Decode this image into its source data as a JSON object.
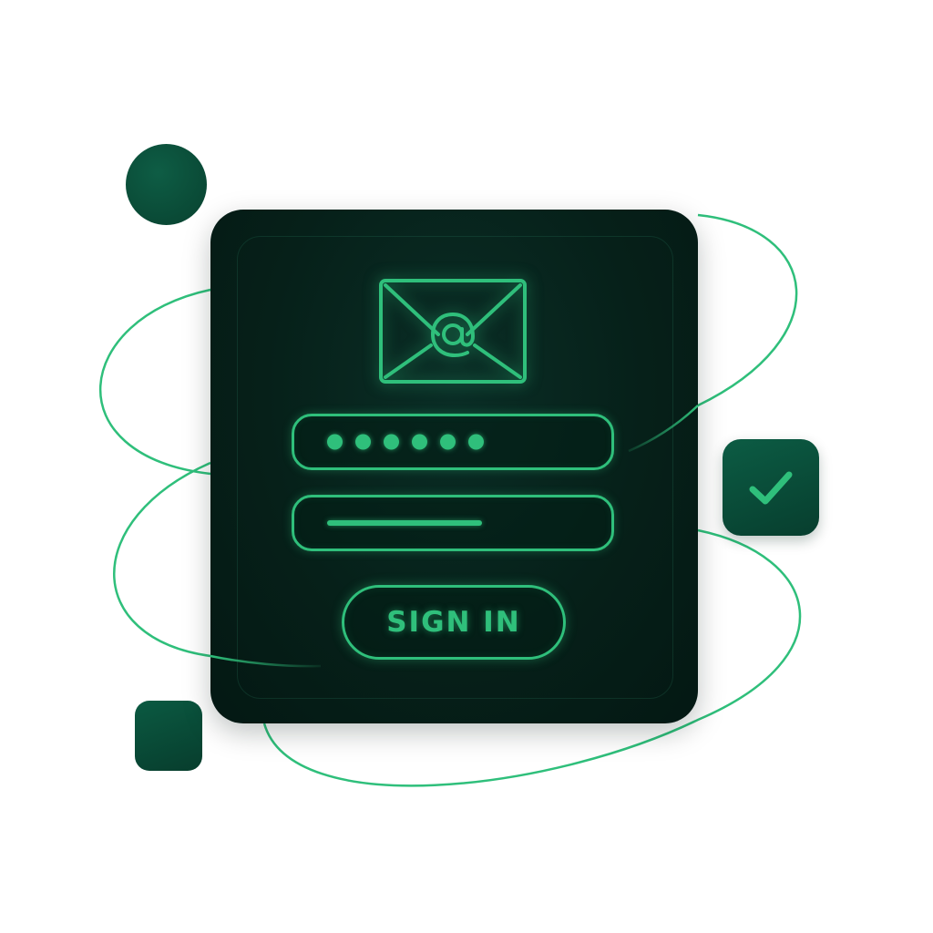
{
  "theme": {
    "accent": "#2fbf7b",
    "panel": "#062019",
    "deco": "#0b5a42",
    "background": "#ffffff"
  },
  "form": {
    "header_icon": "mail-at-icon",
    "password_field": {
      "masked_dots": 6,
      "icon": "password-dots"
    },
    "email_field": {
      "icon": "text-line"
    },
    "submit_label": "SIGN IN"
  },
  "badge": {
    "icon": "check-icon"
  },
  "decorations": [
    "circle",
    "rounded-square",
    "orbit-lines"
  ]
}
